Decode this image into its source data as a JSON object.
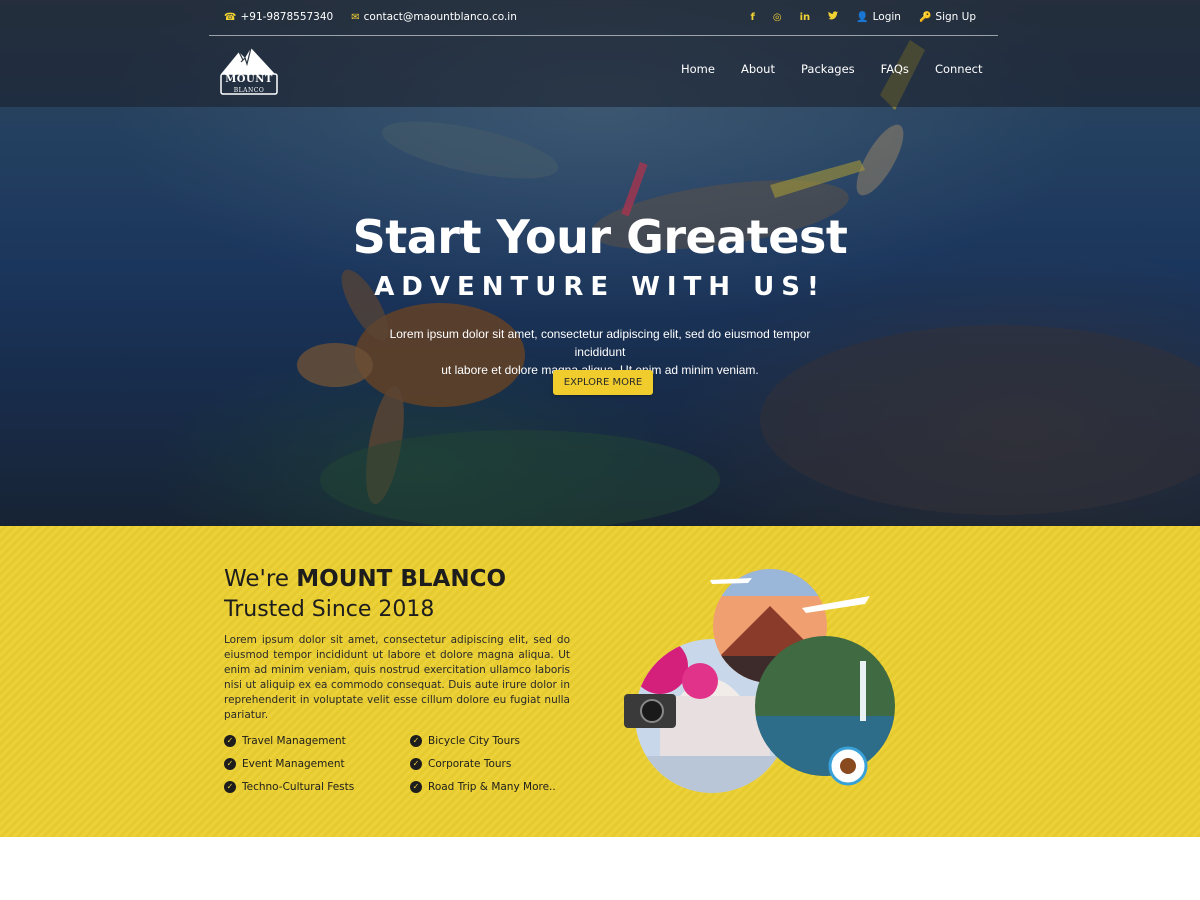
{
  "topbar": {
    "phone": "+91-9878557340",
    "email": "contact@maountblanco.co.in",
    "social": [
      {
        "icon": "facebook-icon",
        "glyph": "f"
      },
      {
        "icon": "instagram-icon",
        "glyph": "◎"
      },
      {
        "icon": "linkedin-icon",
        "glyph": "in"
      },
      {
        "icon": "twitter-icon",
        "glyph": "🐦"
      }
    ],
    "login": "Login",
    "signup": "Sign Up"
  },
  "logo": {
    "line1": "MOUNT",
    "line2": "BLANCO"
  },
  "nav": [
    "Home",
    "About",
    "Packages",
    "FAQs",
    "Connect"
  ],
  "hero": {
    "title": "Start Your Greatest",
    "subtitle": "ADVENTURE WITH US!",
    "description_line1": "Lorem ipsum dolor sit amet, consectetur adipiscing elit, sed do eiusmod tempor incididunt",
    "description_line2": "ut labore et dolore magna aliqua. Ut enim ad minim veniam.",
    "cta": "EXPLORE MORE"
  },
  "about": {
    "heading_prefix": "We're ",
    "heading_brand": "MOUNT BLANCO",
    "subheading": "Trusted Since 2018",
    "paragraph": "Lorem ipsum dolor sit amet, consectetur adipiscing elit, sed do eiusmod tempor incididunt ut labore et dolore magna aliqua. Ut enim ad minim veniam, quis nostrud exercitation ullamco laboris nisi ut aliquip ex ea commodo consequat. Duis aute irure dolor in reprehenderit in voluptate velit esse cillum dolore eu fugiat nulla pariatur.",
    "features": [
      "Travel Management",
      "Bicycle City Tours",
      "Event Management",
      "Corporate Tours",
      "Techno-Cultural Fests",
      "Road Trip & Many More.."
    ]
  },
  "colors": {
    "accent_yellow": "#f0cd2c",
    "section_yellow": "#ecd138",
    "dark_text": "#1d1d1d"
  }
}
